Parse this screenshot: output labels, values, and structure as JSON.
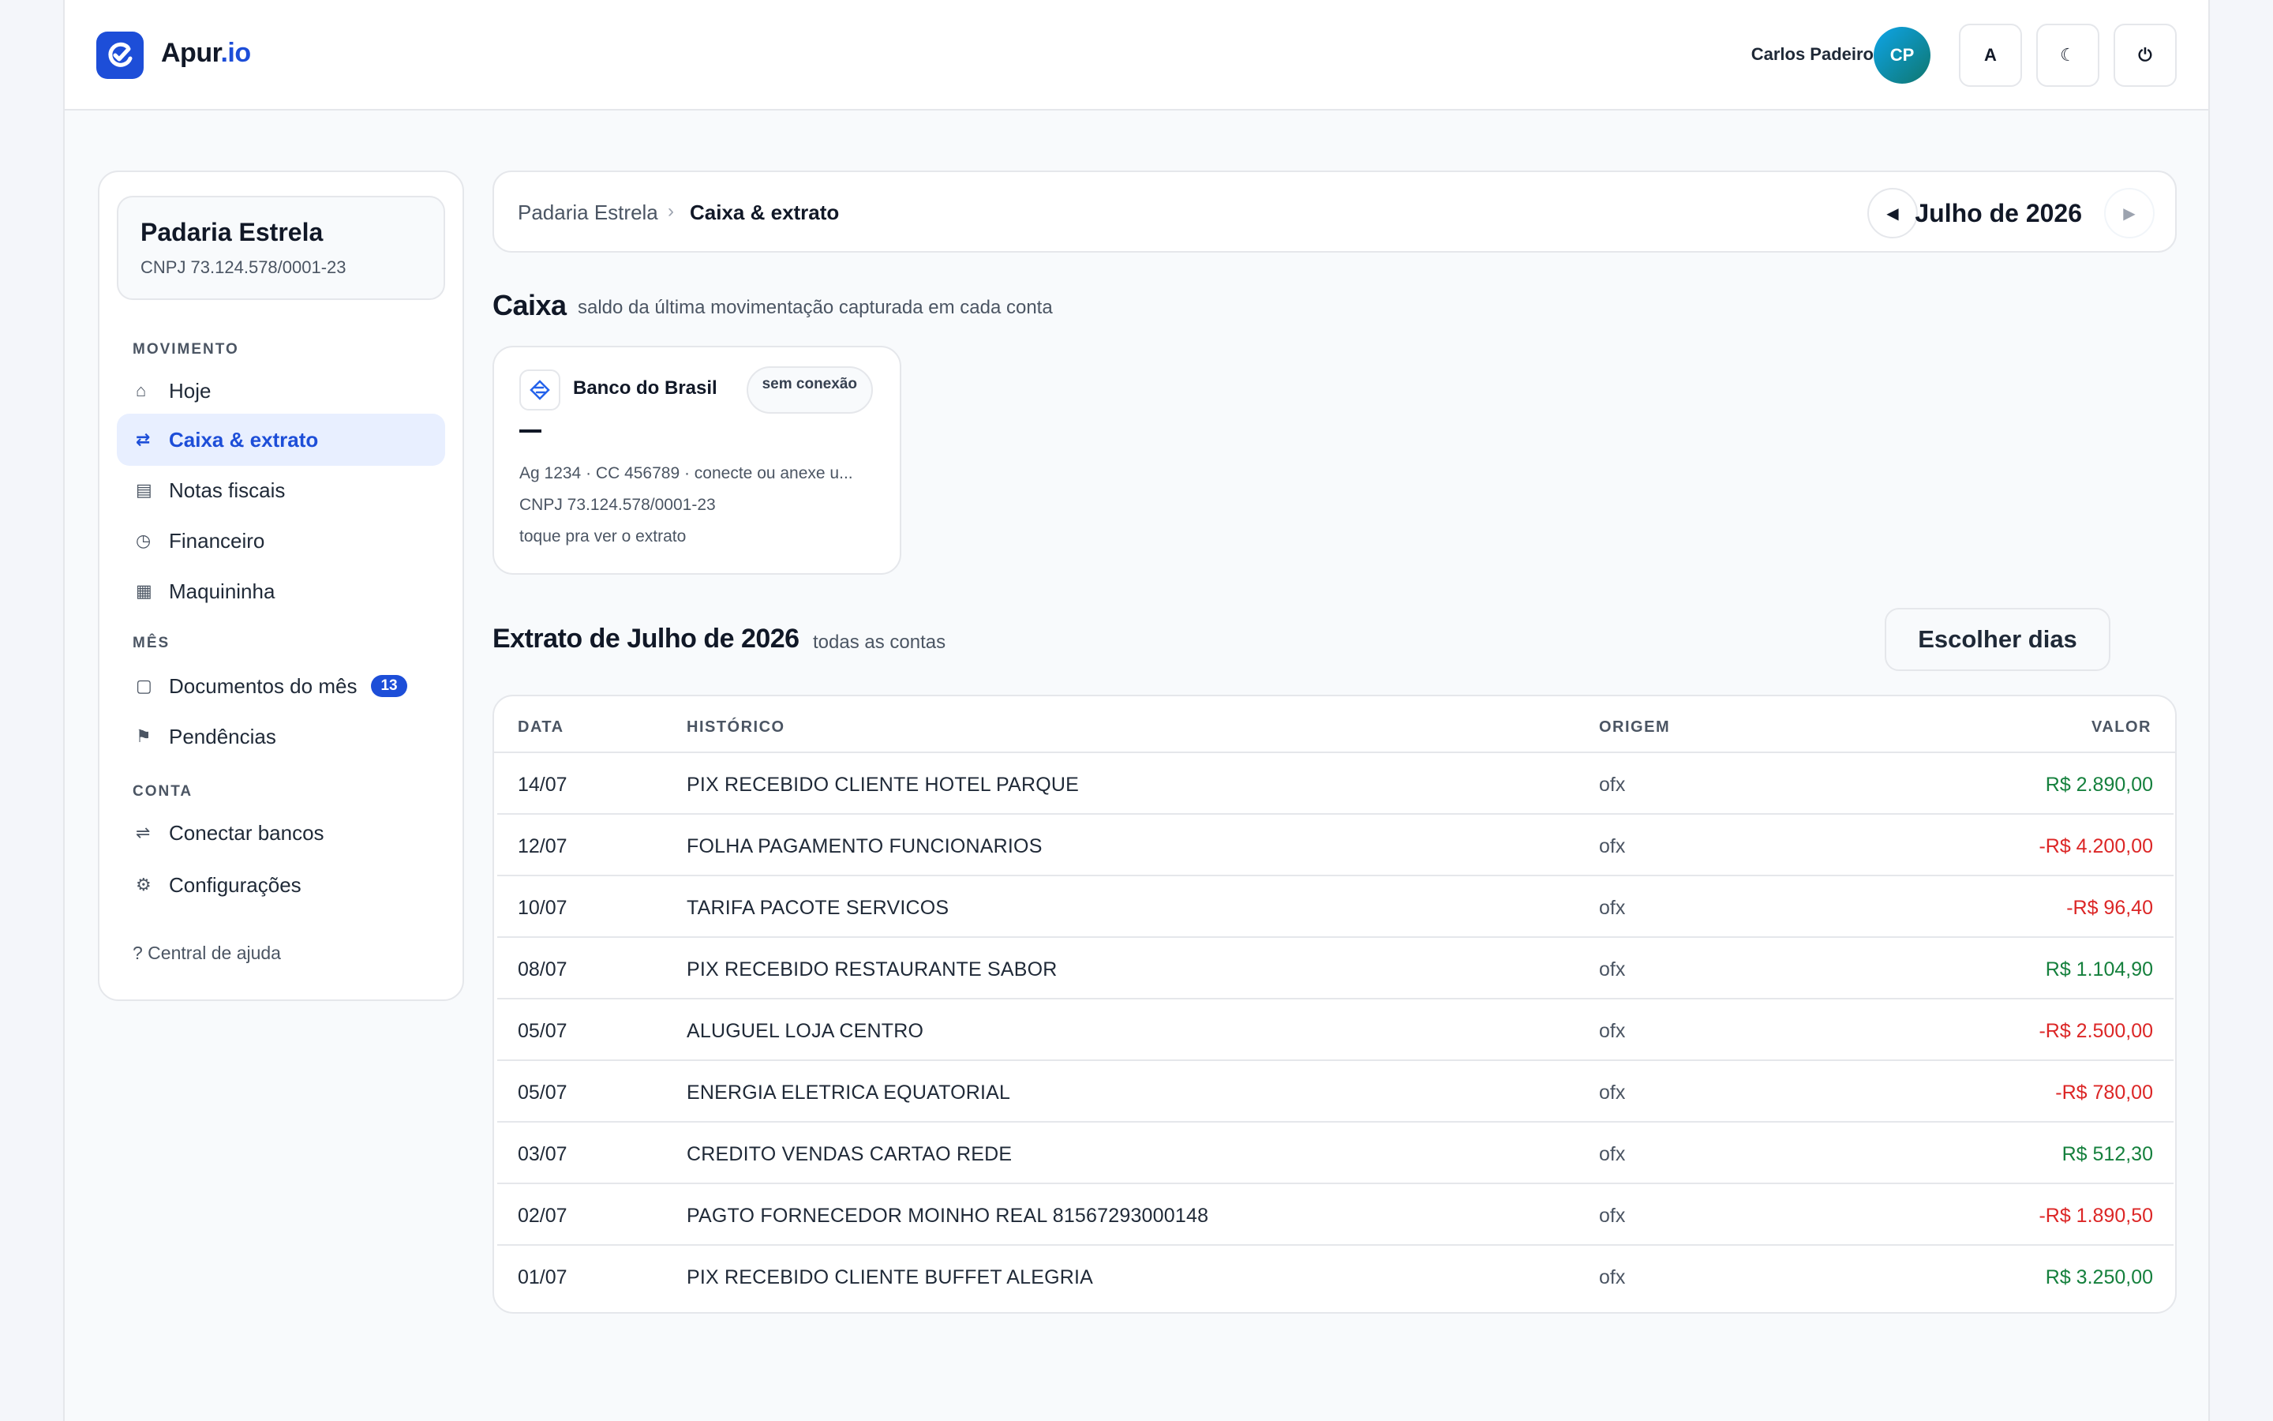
{
  "header": {
    "logo_text_main": "Apur",
    "logo_text_tld": ".io",
    "user_name": "Carlos Padeiro",
    "avatar_initials": "CP",
    "font_button_label": "A",
    "theme_button_label": "☾",
    "logout_button_label": "⏻"
  },
  "sidebar": {
    "company_name": "Padaria Estrela",
    "company_cnpj": "CNPJ 73.124.578/0001-23",
    "sections": {
      "movimento": "MOVIMENTO",
      "mes": "MÊS",
      "conta": "CONTA"
    },
    "items": [
      {
        "label": "Hoje",
        "icon": "⌂",
        "icon_name": "home-icon"
      },
      {
        "label": "Caixa & extrato",
        "icon": "⇄",
        "icon_name": "transfer-icon",
        "active": true
      },
      {
        "label": "Notas fiscais",
        "icon": "▤",
        "icon_name": "invoice-icon"
      },
      {
        "label": "Financeiro",
        "icon": "◷",
        "icon_name": "clock-icon"
      },
      {
        "label": "Maquininha",
        "icon": "▦",
        "icon_name": "card-machine-icon"
      },
      {
        "label": "Documentos do mês",
        "icon": "▢",
        "icon_name": "document-icon",
        "badge": "13"
      },
      {
        "label": "Pendências",
        "icon": "⚑",
        "icon_name": "flag-icon"
      },
      {
        "label": "Conectar bancos",
        "icon": "⇌",
        "icon_name": "connect-icon"
      },
      {
        "label": "Configurações",
        "icon": "⚙",
        "icon_name": "gear-icon"
      }
    ],
    "help_link": "? Central de ajuda"
  },
  "breadcrumb": {
    "root": "Padaria Estrela",
    "separator": "›",
    "current": "Caixa & extrato"
  },
  "month_nav": {
    "prev_label": "◀",
    "label": "Julho de 2026",
    "next_label": "▶"
  },
  "caixa": {
    "title": "Caixa",
    "subtitle": "saldo da última movimentação capturada em cada conta",
    "accounts": [
      {
        "bank_name": "Banco do Brasil",
        "status": "sem conexão",
        "balance": "—",
        "details": "Ag 1234 · CC 456789 · conecte ou anexe u...",
        "cnpj": "CNPJ 73.124.578/0001-23",
        "hint": "toque pra ver o extrato"
      }
    ]
  },
  "extrato": {
    "title": "Extrato de Julho de 2026",
    "subtitle": "todas as contas",
    "choose_days_label": "Escolher dias",
    "columns": {
      "date": "DATA",
      "history": "HISTÓRICO",
      "origin": "ORIGEM",
      "value": "VALOR"
    },
    "rows": [
      {
        "date": "14/07",
        "history": "PIX RECEBIDO CLIENTE HOTEL PARQUE",
        "origin": "ofx",
        "value": "R$ 2.890,00",
        "sign": "pos"
      },
      {
        "date": "12/07",
        "history": "FOLHA PAGAMENTO FUNCIONARIOS",
        "origin": "ofx",
        "value": "-R$ 4.200,00",
        "sign": "neg"
      },
      {
        "date": "10/07",
        "history": "TARIFA PACOTE SERVICOS",
        "origin": "ofx",
        "value": "-R$ 96,40",
        "sign": "neg"
      },
      {
        "date": "08/07",
        "history": "PIX RECEBIDO RESTAURANTE SABOR",
        "origin": "ofx",
        "value": "R$ 1.104,90",
        "sign": "pos"
      },
      {
        "date": "05/07",
        "history": "ALUGUEL LOJA CENTRO",
        "origin": "ofx",
        "value": "-R$ 2.500,00",
        "sign": "neg"
      },
      {
        "date": "05/07",
        "history": "ENERGIA ELETRICA EQUATORIAL",
        "origin": "ofx",
        "value": "-R$ 780,00",
        "sign": "neg"
      },
      {
        "date": "03/07",
        "history": "CREDITO VENDAS CARTAO REDE",
        "origin": "ofx",
        "value": "R$ 512,30",
        "sign": "pos"
      },
      {
        "date": "02/07",
        "history": "PAGTO FORNECEDOR MOINHO REAL 81567293000148",
        "origin": "ofx",
        "value": "-R$ 1.890,50",
        "sign": "neg"
      },
      {
        "date": "01/07",
        "history": "PIX RECEBIDO CLIENTE BUFFET ALEGRIA",
        "origin": "ofx",
        "value": "R$ 3.250,00",
        "sign": "pos"
      }
    ]
  },
  "colors": {
    "accent": "#1d4ed8",
    "positive": "#15803d",
    "negative": "#dc2626",
    "active_nav_bg": "#e8efff"
  }
}
